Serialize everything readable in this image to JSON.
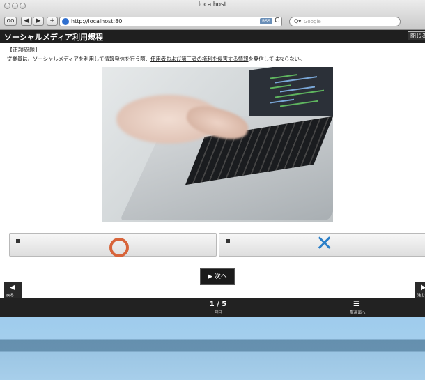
{
  "window": {
    "title": "localhost"
  },
  "toolbar": {
    "url": "http://localhost:80",
    "rss": "RSS",
    "reload": "C",
    "search_prefix": "Q▾",
    "search_placeholder": "Google"
  },
  "header": {
    "title": "ソーシャルメディア利用規程",
    "close_label": "閉じる"
  },
  "question": {
    "label": "【正誤問題】",
    "text_before": "従業員は、ソーシャルメディアを利用して情報発信を行う際、",
    "text_underlined": "使用者および第三者の権利を侵害する情報",
    "text_after": "を発信してはならない。"
  },
  "answers": [
    {
      "symbol": "circle-mark",
      "color": "#d8643a"
    },
    {
      "symbol": "cross-mark",
      "color": "#2a7fc8"
    }
  ],
  "nav": {
    "next_label": "▶ 次へ",
    "back_label": "戻る",
    "forward_label": "進む",
    "page": "1 / 5",
    "page_unit": "問目",
    "list_label": "一覧画面へ"
  }
}
